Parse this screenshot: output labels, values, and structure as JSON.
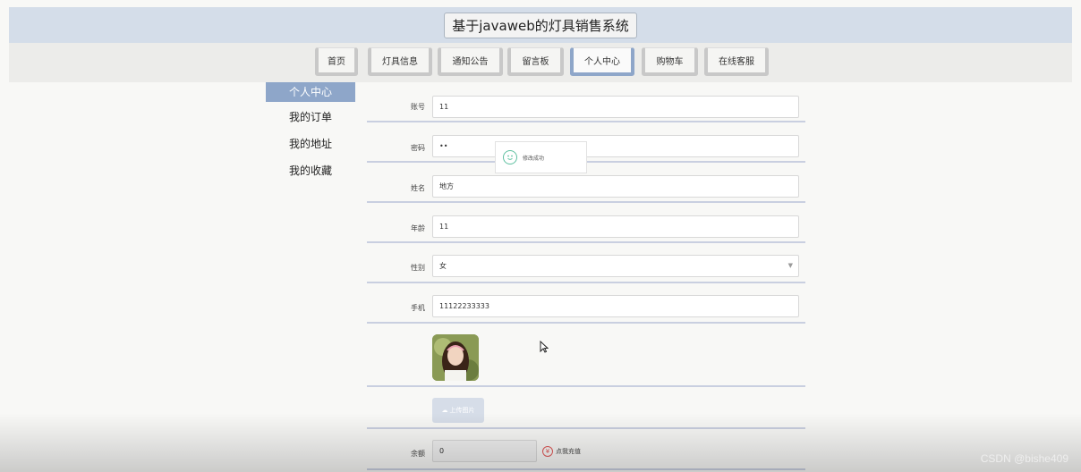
{
  "header": {
    "title": "基于javaweb的灯具销售系统"
  },
  "nav": {
    "items": [
      "首页",
      "灯具信息",
      "通知公告",
      "留言板",
      "个人中心",
      "购物车",
      "在线客服"
    ],
    "active": "个人中心"
  },
  "sidebar": {
    "items": [
      "个人中心",
      "我的订单",
      "我的地址",
      "我的收藏"
    ],
    "active": "个人中心"
  },
  "form": {
    "account_label": "账号",
    "account_value": "11",
    "password_label": "密码",
    "password_value": "••",
    "name_label": "姓名",
    "name_value": "地方",
    "age_label": "年龄",
    "age_value": "11",
    "gender_label": "性别",
    "gender_value": "女",
    "phone_label": "手机",
    "phone_value": "11122233333",
    "upload_label": "上传图片",
    "balance_label": "余额",
    "balance_value": "0",
    "recharge_label": "点我充值"
  },
  "toast": {
    "message": "修改成功",
    "icon": "smile-icon"
  },
  "watermark": "CSDN @bishe409",
  "colors": {
    "accent": "#8ea6c9",
    "header_bg": "#d4dde9",
    "success": "#5fc0a0",
    "recharge": "#e05555"
  }
}
